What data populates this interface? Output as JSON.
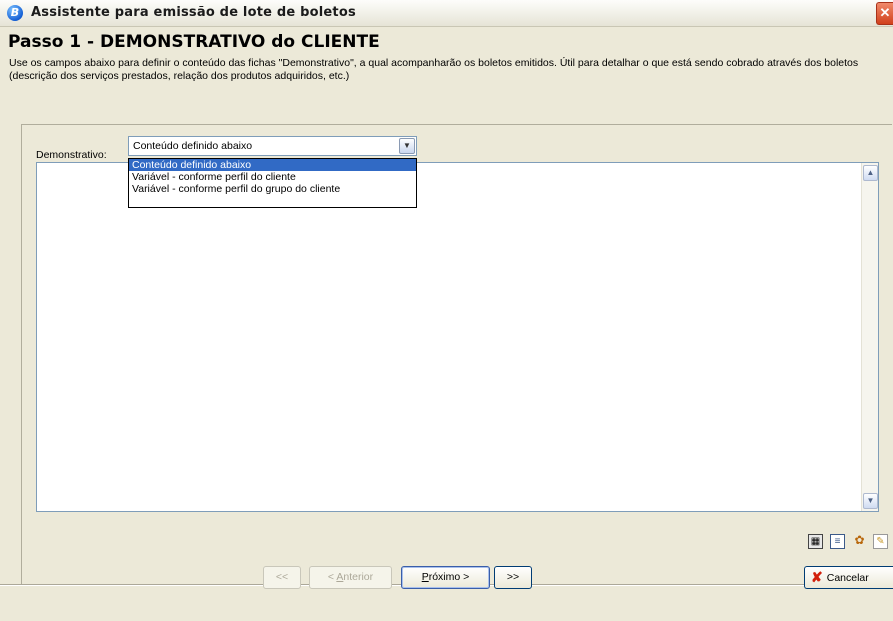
{
  "window": {
    "title": "Assistente para emissão de lote de boletos",
    "icon": "app-logo-icon",
    "close_glyph": "✕"
  },
  "step": {
    "title": "Passo 1 - DEMONSTRATIVO do CLIENTE",
    "description": "Use os campos abaixo para definir o conteúdo das fichas \"Demonstrativo\", a qual acompanharão os boletos emitidos. Útil para detalhar o que está sendo cobrado através dos boletos (descrição dos serviços prestados, relação dos produtos adquiridos, etc.)"
  },
  "demonstrativo": {
    "label": "Demonstrativo:",
    "selected": "Conteúdo definido abaixo",
    "options": [
      "Conteúdo definido abaixo",
      "Variável - conforme perfil do cliente",
      "Variável - conforme perfil do grupo do cliente"
    ]
  },
  "editor": {
    "content": ""
  },
  "toolbar": {
    "icons": [
      "table-icon",
      "document-icon",
      "palette-icon",
      "page-icon"
    ]
  },
  "nav": {
    "first_label": "<<",
    "prev_label_accel": "A",
    "prev_label_rest": "nterior",
    "prev_prefix": "< ",
    "next_label_accel": "P",
    "next_label_rest": "róximo >",
    "last_label": ">>",
    "cancel_label": "Cancelar"
  },
  "colors": {
    "selection": "#316ac5",
    "dialog_bg": "#ece9d8",
    "cancel_icon": "#d2200c"
  }
}
